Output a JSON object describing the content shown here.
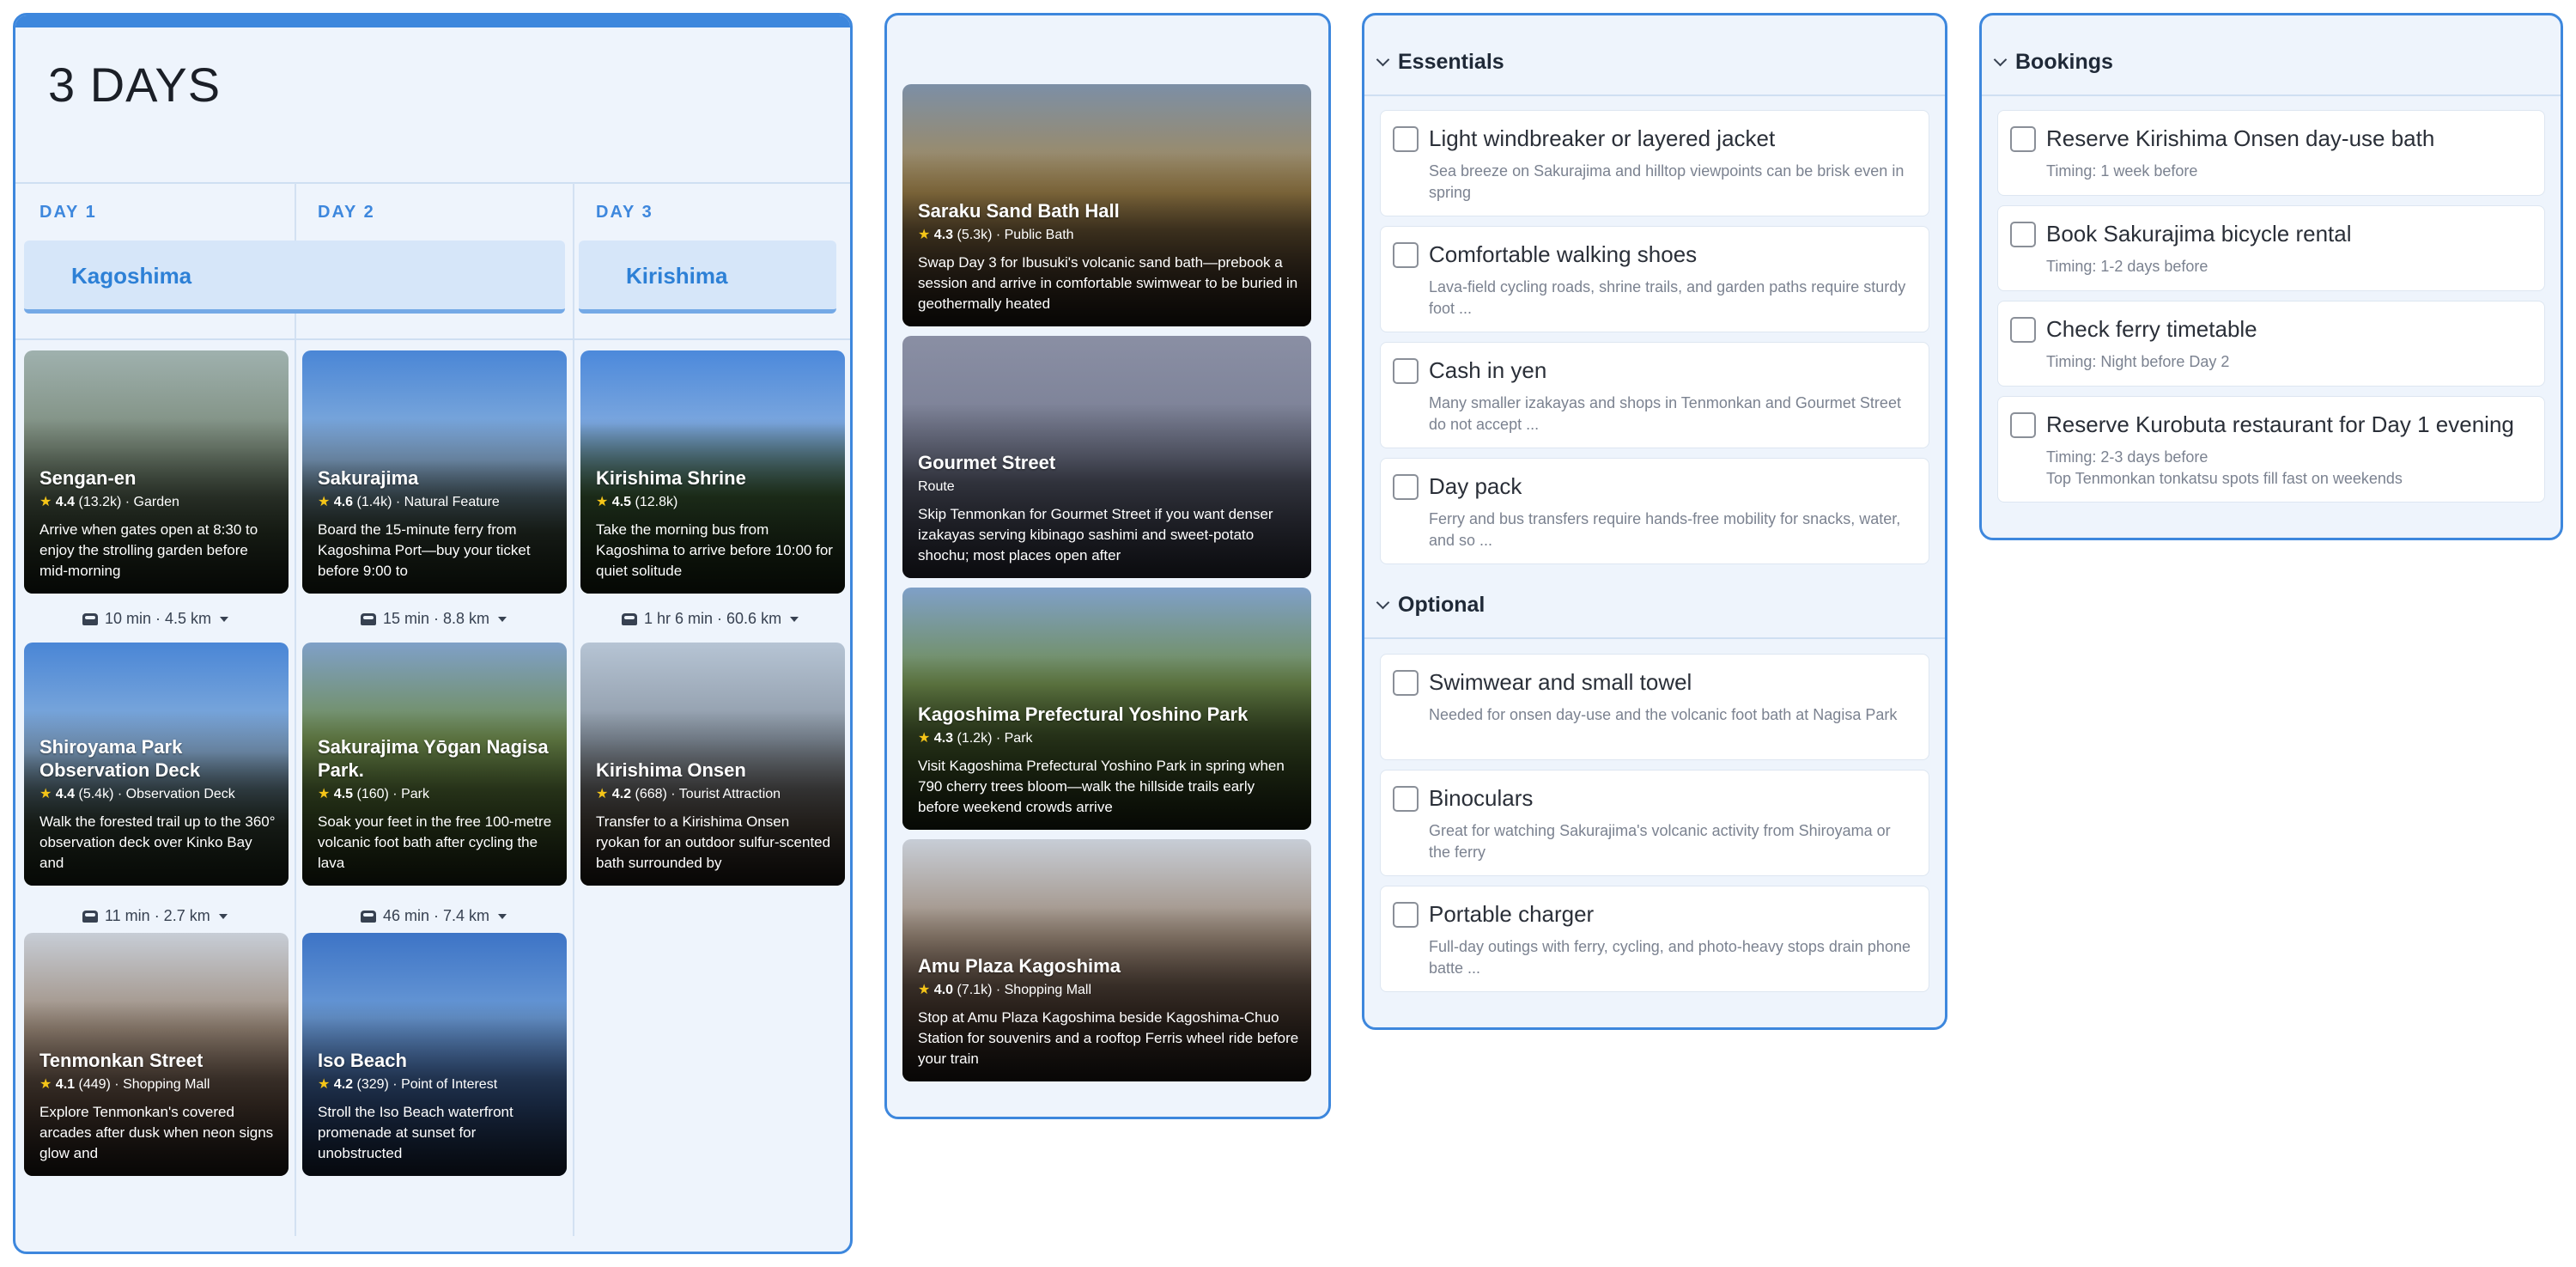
{
  "itinerary": {
    "title": "3 DAYS",
    "days": [
      {
        "label": "DAY 1",
        "region": "Kagoshima"
      },
      {
        "label": "DAY 2",
        "region": ""
      },
      {
        "label": "DAY 3",
        "region": "Kirishima"
      }
    ],
    "cards": [
      {
        "name": "Sengan-en",
        "rating": "4.4",
        "reviews": "(13.2k)",
        "category": "Garden",
        "desc": "Arrive when gates open at 8:30 to enjoy the strolling garden before mid-morning"
      },
      {
        "name": "Sakurajima",
        "rating": "4.6",
        "reviews": "(1.4k)",
        "category": "Natural Feature",
        "desc": "Board the 15-minute ferry from Kagoshima Port—buy your ticket before 9:00 to"
      },
      {
        "name": "Kirishima Shrine",
        "rating": "4.5",
        "reviews": "(12.8k)",
        "category": "",
        "desc": "Take the morning bus from Kagoshima to arrive before 10:00 for quiet solitude"
      },
      {
        "name": "Shiroyama Park Observation Deck",
        "rating": "4.4",
        "reviews": "(5.4k)",
        "category": "Observation Deck",
        "desc": "Walk the forested trail up to the 360° observation deck over Kinko Bay and"
      },
      {
        "name": "Sakurajima Yōgan Nagisa Park.",
        "rating": "4.5",
        "reviews": "(160)",
        "category": "Park",
        "desc": "Soak your feet in the free 100-metre volcanic foot bath after cycling the lava"
      },
      {
        "name": "Kirishima Onsen",
        "rating": "4.2",
        "reviews": "(668)",
        "category": "Tourist Attraction",
        "desc": "Transfer to a Kirishima Onsen ryokan for an outdoor sulfur-scented bath surrounded by"
      },
      {
        "name": "Tenmonkan Street",
        "rating": "4.1",
        "reviews": "(449)",
        "category": "Shopping Mall",
        "desc": "Explore Tenmonkan's covered arcades after dusk when neon signs glow and"
      },
      {
        "name": "Iso Beach",
        "rating": "4.2",
        "reviews": "(329)",
        "category": "Point of Interest",
        "desc": "Stroll the Iso Beach waterfront promenade at sunset for unobstructed"
      }
    ],
    "commutes": [
      "10 min · 4.5 km",
      "15 min · 8.8 km",
      "1 hr 6 min · 60.6 km",
      "11 min · 2.7 km",
      "46 min · 7.4 km"
    ]
  },
  "ideas": [
    {
      "name": "Saraku Sand Bath Hall",
      "rating": "4.3",
      "reviews": "(5.3k)",
      "category": "Public Bath",
      "desc": "Swap Day 3 for Ibusuki's volcanic sand bath—prebook a session and arrive in comfortable swimwear to be buried in geothermally heated"
    },
    {
      "name": "Gourmet Street",
      "rating": "",
      "reviews": "",
      "category": "Route",
      "desc": "Skip Tenmonkan for Gourmet Street if you want denser izakayas serving kibinago sashimi and sweet-potato shochu; most places open after"
    },
    {
      "name": "Kagoshima Prefectural Yoshino Park",
      "rating": "4.3",
      "reviews": "(1.2k)",
      "category": "Park",
      "desc": "Visit Kagoshima Prefectural Yoshino Park in spring when 790 cherry trees bloom—walk the hillside trails early before weekend crowds arrive"
    },
    {
      "name": "Amu Plaza Kagoshima",
      "rating": "4.0",
      "reviews": "(7.1k)",
      "category": "Shopping Mall",
      "desc": "Stop at Amu Plaza Kagoshima beside Kagoshima-Chuo Station for souvenirs and a rooftop Ferris wheel ride before your train"
    }
  ],
  "packing": {
    "essentials_title": "Essentials",
    "optional_title": "Optional",
    "essentials": [
      {
        "title": "Light windbreaker or layered jacket",
        "desc": "Sea breeze on Sakurajima and hilltop viewpoints can be brisk even in spring"
      },
      {
        "title": "Comfortable walking shoes",
        "desc": "Lava-field cycling roads, shrine trails, and garden paths require sturdy foot ..."
      },
      {
        "title": "Cash in yen",
        "desc": "Many smaller izakayas and shops in Tenmonkan and Gourmet Street do not accept ..."
      },
      {
        "title": "Day pack",
        "desc": "Ferry and bus transfers require hands-free mobility for snacks, water, and so ..."
      }
    ],
    "optional": [
      {
        "title": "Swimwear and small towel",
        "desc": "Needed for onsen day-use and the volcanic foot bath at Nagisa Park"
      },
      {
        "title": "Binoculars",
        "desc": "Great for watching Sakurajima's volcanic activity from Shiroyama or the ferry"
      },
      {
        "title": "Portable charger",
        "desc": "Full-day outings with ferry, cycling, and photo-heavy stops drain phone batte ..."
      }
    ]
  },
  "bookings": {
    "title": "Bookings",
    "items": [
      {
        "title": "Reserve Kirishima Onsen day-use bath",
        "desc": "Timing: 1 week before"
      },
      {
        "title": "Book Sakurajima bicycle rental",
        "desc": "Timing: 1-2 days before"
      },
      {
        "title": "Check ferry timetable",
        "desc": "Timing: Night before Day 2"
      },
      {
        "title": "Reserve Kurobuta restaurant for Day 1 evening",
        "desc": "Timing: 2-3 days before",
        "note": "Top Tenmonkan tonkatsu spots fill fast on weekends"
      }
    ]
  },
  "colors": {
    "accent": "#3d87dd",
    "panel_bg": "#eef4fc",
    "star": "#f5c518"
  }
}
